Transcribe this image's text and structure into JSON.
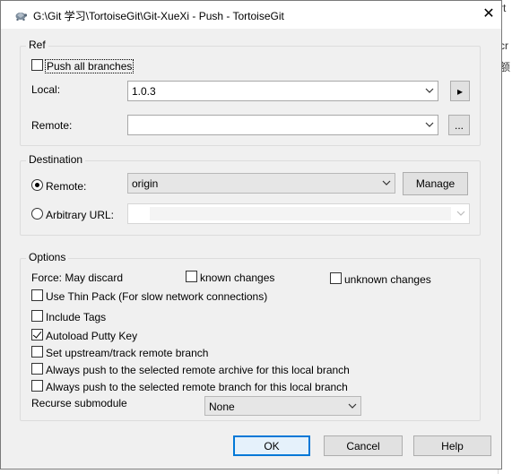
{
  "window": {
    "title": "G:\\Git 学习\\TortoiseGit\\Git-XueXi - Push - TortoiseGit",
    "close_glyph": "✕",
    "icon": "tortoise-icon"
  },
  "background": {
    "fragments": [
      "rt",
      "cr",
      "额"
    ]
  },
  "ref": {
    "group_label": "Ref",
    "push_all": {
      "label": "Push all branches",
      "checked": false
    },
    "local": {
      "label": "Local:",
      "value": "1.0.3",
      "arrow_button": "▸"
    },
    "remote": {
      "label": "Remote:",
      "value": "",
      "browse_button": "..."
    }
  },
  "destination": {
    "group_label": "Destination",
    "remote": {
      "label": "Remote:",
      "value": "origin",
      "selected": true
    },
    "manage_button": "Manage",
    "arbitrary": {
      "label": "Arbitrary URL:",
      "value": "",
      "selected": false
    }
  },
  "options": {
    "group_label": "Options",
    "force_label": "Force: May discard",
    "known_changes": {
      "label": "known changes",
      "checked": false
    },
    "unknown_changes": {
      "label": "unknown changes",
      "checked": false
    },
    "thin_pack": {
      "label": "Use Thin Pack (For slow network connections)",
      "checked": false
    },
    "include_tags": {
      "label": "Include Tags",
      "checked": false
    },
    "autoload_putty": {
      "label": "Autoload Putty Key",
      "checked": true
    },
    "set_upstream": {
      "label": "Set upstream/track remote branch",
      "checked": false
    },
    "push_archive": {
      "label": "Always push to the selected remote archive for this local branch",
      "checked": false
    },
    "push_branch": {
      "label": "Always push to the selected remote branch for this local branch",
      "checked": false
    },
    "recurse_label": "Recurse submodule",
    "recurse_value": "None"
  },
  "buttons": {
    "ok": "OK",
    "cancel": "Cancel",
    "help": "Help"
  }
}
